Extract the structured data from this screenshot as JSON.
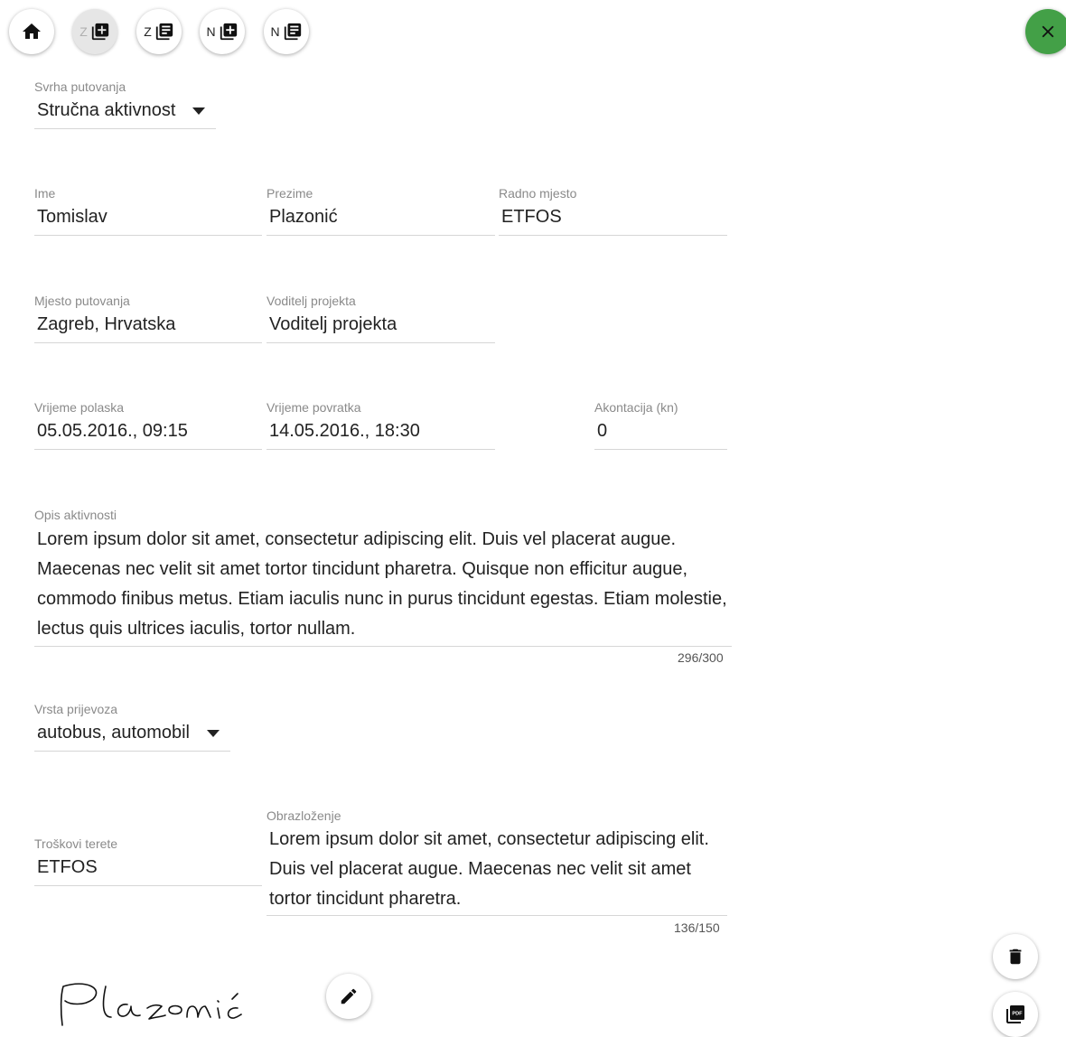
{
  "toolbar": {
    "btn_z_add_letter": "Z",
    "btn_z_list_letter": "Z",
    "btn_n_add_letter": "N",
    "btn_n_list_letter": "N"
  },
  "form": {
    "svrha": {
      "label": "Svrha putovanja",
      "value": "Stručna aktivnost"
    },
    "ime": {
      "label": "Ime",
      "value": "Tomislav"
    },
    "prezime": {
      "label": "Prezime",
      "value": "Plazonić"
    },
    "radno_mjesto": {
      "label": "Radno mjesto",
      "value": "ETFOS"
    },
    "mjesto_putovanja": {
      "label": "Mjesto putovanja",
      "value": "Zagreb, Hrvatska"
    },
    "voditelj": {
      "label": "Voditelj projekta",
      "value": "Voditelj projekta"
    },
    "polazak": {
      "label": "Vrijeme polaska",
      "value": "05.05.2016., 09:15"
    },
    "povratak": {
      "label": "Vrijeme povratka",
      "value": "14.05.2016., 18:30"
    },
    "akontacija": {
      "label": "Akontacija (kn)",
      "value": "0"
    },
    "opis": {
      "label": "Opis aktivnosti",
      "value": "Lorem ipsum dolor sit amet, consectetur adipiscing elit. Duis vel placerat augue. Maecenas nec velit sit amet tortor tincidunt pharetra. Quisque non efficitur augue, commodo finibus metus. Etiam iaculis nunc in purus tincidunt egestas. Etiam molestie, lectus quis ultrices iaculis, tortor nullam.",
      "counter": "296/300"
    },
    "prijevoz": {
      "label": "Vrsta prijevoza",
      "value": "autobus, automobil"
    },
    "troskovi": {
      "label": "Troškovi terete",
      "value": "ETFOS"
    },
    "obrazlozenje": {
      "label": "Obrazloženje",
      "value": "Lorem ipsum dolor sit amet, consectetur adipiscing elit. Duis vel placerat augue. Maecenas nec velit sit amet tortor tincidunt pharetra.",
      "counter": "136/150"
    }
  },
  "signature": {
    "text": "Plazonić"
  },
  "colors": {
    "accent_green": "#43a047"
  }
}
